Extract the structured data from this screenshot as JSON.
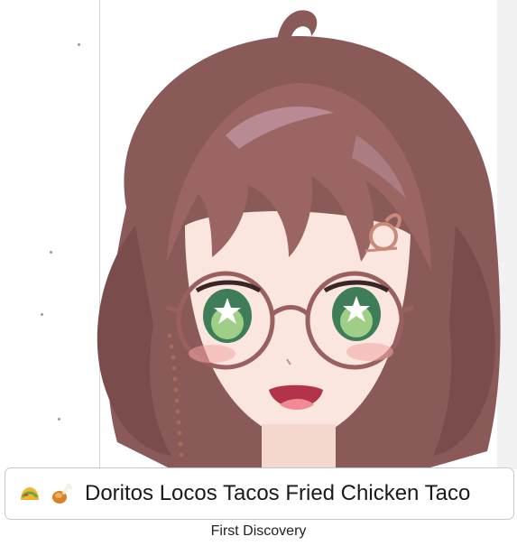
{
  "card": {
    "title": "Doritos Locos Tacos Fried Chicken Taco",
    "subtitle": "First Discovery",
    "icons": [
      "taco-icon",
      "chicken-drumstick-icon"
    ]
  },
  "colors": {
    "hair": "#8a5a58",
    "hair_dark": "#5e3a3c",
    "skin": "#fbe6df",
    "eyes": "#4e9a6a",
    "glasses": "#9a6060",
    "border": "#c9c9c9",
    "text": "#1a1a1a"
  }
}
